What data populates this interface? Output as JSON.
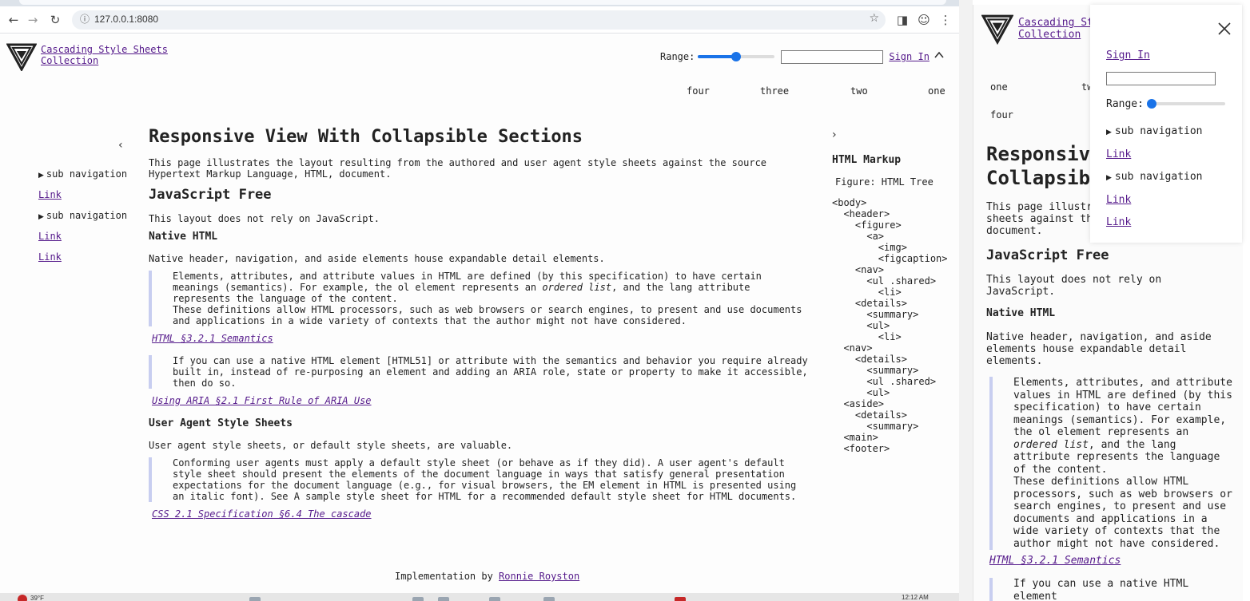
{
  "browser": {
    "url": "127.0.0.1:8080"
  },
  "site": {
    "brand_line1": "Cascading Style Sheets",
    "brand_line2": "Collection",
    "range_label": "Range:",
    "range_value": 0.5,
    "signin": "Sign In",
    "nav": [
      "four",
      "three",
      "two",
      "one"
    ]
  },
  "sidebar": {
    "items": [
      {
        "type": "summary",
        "label": "sub navigation"
      },
      {
        "type": "link",
        "label": "Link"
      },
      {
        "type": "summary",
        "label": "sub navigation"
      },
      {
        "type": "link",
        "label": "Link"
      },
      {
        "type": "link",
        "label": "Link"
      }
    ]
  },
  "article": {
    "title": "Responsive View With Collapsible Sections",
    "intro": "This page illustrates the layout resulting from the authored and user agent style sheets against the source Hypertext Markup Language, HTML, document.",
    "h2_js": "JavaScript Free",
    "p_js": "This layout does not rely on JavaScript.",
    "h3_native": "Native HTML",
    "p_native": "Native header, navigation, and aside elements house expandable detail elements.",
    "quote1_pre": "Elements, attributes, and attribute values in HTML are defined (by this specification) to have certain meanings (semantics). For example, the ol element represents an ",
    "quote1_em": "ordered list",
    "quote1_post": ", and the lang attribute represents the language of the content.",
    "quote1_b": "These definitions allow HTML processors, such as web browsers or search engines, to present and use documents and applications in a wide variety of contexts that the author might not have considered.",
    "cite1": "HTML §3.2.1 Semantics",
    "quote2": "If you can use a native HTML element [HTML51] or attribute with the semantics and behavior you require already built in, instead of re-purposing an element and adding an ARIA role, state or property to make it accessible, then do so.",
    "cite2": "Using ARIA §2.1 First Rule of ARIA Use",
    "h3_ua": "User Agent Style Sheets",
    "p_ua": "User agent style sheets, or default style sheets, are valuable.",
    "quote3": "Conforming user agents must apply a default style sheet (or behave as if they did). A user agent's default style sheet should present the elements of the document language in ways that satisfy general presentation expectations for the document language (e.g., for visual browsers, the EM element in HTML is presented using an italic font). See A sample style sheet for HTML for a recommended default style sheet for HTML documents.",
    "cite3": "CSS 2.1 Specification §6.4 The cascade"
  },
  "aside": {
    "title": "HTML Markup",
    "figcaption": "Figure: HTML Tree",
    "tree": [
      "<body>",
      "  <header>",
      "    <figure>",
      "      <a>",
      "        <img>",
      "        <figcaption>",
      "    <nav>",
      "      <ul .shared>",
      "        <li>",
      "    <details>",
      "      <summary>",
      "      <ul>",
      "        <li>",
      "  <nav>",
      "    <details>",
      "      <summary>",
      "      <ul .shared>",
      "      <ul>",
      "  <aside>",
      "    <details>",
      "      <summary>",
      "  <main>",
      "  <footer>"
    ]
  },
  "footer": {
    "prefix": "Implementation by ",
    "author": "Ronnie Royston"
  },
  "taskbar": {
    "temp": "39°F",
    "time": "12:12 AM"
  },
  "mobile": {
    "brand_line1": "Cascading Sty",
    "brand_line2": "Collection",
    "nav_one": "one",
    "nav_two": "tw",
    "nav_four": "four",
    "title_line1": "Responsive",
    "title_line2": "Collapsibl",
    "intro": "This page illustrat from the authored a sheets against the Language, HTML, document.",
    "h2_js": "JavaScript Free",
    "p_js": "This layout does not rely on JavaScript.",
    "h3_native": "Native HTML",
    "p_native": "Native header, navigation, and aside elements house expandable detail elements.",
    "quote1_pre": "Elements, attributes, and attribute values in HTML are defined (by this specification) to have certain meanings (semantics). For example, the ol element represents an ",
    "quote1_em": "ordered list",
    "quote1_post": ", and the lang attribute represents the language of the content.",
    "quote1_b": "These definitions allow HTML processors, such as web browsers or search engines, to present and use documents and applications in a wide variety of contexts that the author might not have considered.",
    "cite1": "HTML §3.2.1 Semantics",
    "quote2": "If you can use a native HTML element",
    "drawer": {
      "signin": "Sign In",
      "range_label": "Range:",
      "range_value": 0.0,
      "summary1": "sub navigation",
      "link1": "Link",
      "summary2": "sub navigation",
      "link2": "Link",
      "link3": "Link"
    }
  },
  "colors": {
    "accent": "#1a73e8",
    "link": "#551a8b",
    "quote_border": "#c8cef0"
  }
}
